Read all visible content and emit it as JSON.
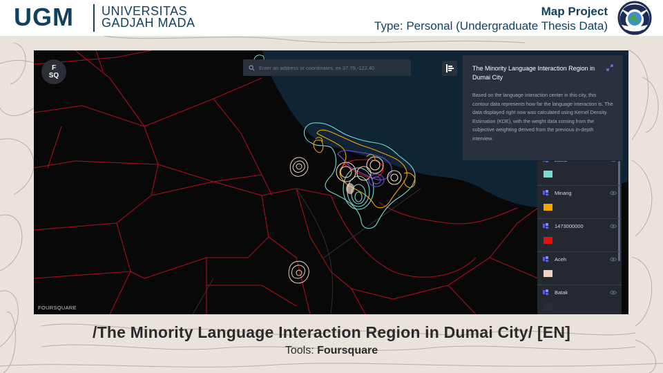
{
  "header": {
    "logo_text": "UGM",
    "university_line1": "UNIVERSITAS",
    "university_line2": "GADJAH MADA",
    "project_title": "Map Project",
    "project_type": "Type: Personal (Undergraduate Thesis Data)"
  },
  "map": {
    "badge_line1": "F",
    "badge_line2": "SQ",
    "search_placeholder": "Enter an address or coordinates, ex 37.79,-122.40",
    "attribution": "FOURSQUARE",
    "info_panel": {
      "title": "The Minority Language Interaction Region in Dumai City",
      "body": "Based on the language interaction center in this city, this contour data represents how far the language interaction is. The data displayed right now was calculated using Kernel Density Estimation (KDE), with the weight data coming from the subjective weighting derived from the previous in-depth interview."
    },
    "layers": [
      {
        "name": "Jawa",
        "color": "#79dad3"
      },
      {
        "name": "Minang",
        "color": "#f5a400"
      },
      {
        "name": "1473000000",
        "color": "#e0120f"
      },
      {
        "name": "Aceh",
        "color": "#efd4c0"
      },
      {
        "name": "Batak",
        "color": "#2a2f37"
      }
    ]
  },
  "caption": {
    "title": "/The Minority Language Interaction Region in Dumai City/ [EN]",
    "tools_label": "Tools: ",
    "tools_value": "Foursquare"
  },
  "colors": {
    "brand": "#11415c",
    "sea": "#0f2535",
    "boundary": "#b3111a"
  }
}
